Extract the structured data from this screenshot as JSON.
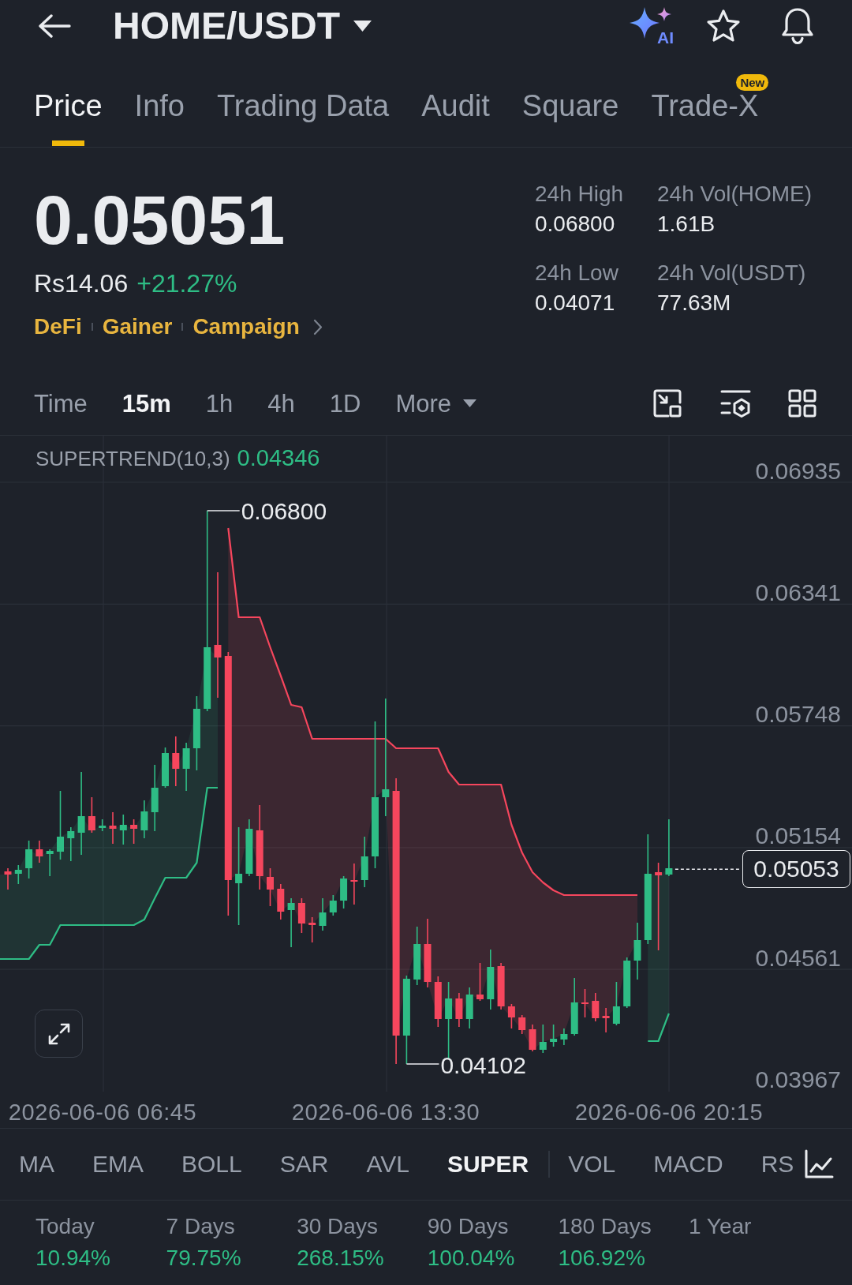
{
  "header": {
    "pair": "HOME/USDT",
    "ai_label": "AI"
  },
  "tabs": [
    {
      "label": "Price",
      "selected": true
    },
    {
      "label": "Info",
      "selected": false
    },
    {
      "label": "Trading Data",
      "selected": false
    },
    {
      "label": "Audit",
      "selected": false
    },
    {
      "label": "Square",
      "selected": false
    },
    {
      "label": "Trade-X",
      "selected": false,
      "badge": "New"
    }
  ],
  "ticker": {
    "last_price": "0.05051",
    "fiat_price": "Rs14.06",
    "change": "+21.27%",
    "tags": [
      "DeFi",
      "Gainer",
      "Campaign"
    ]
  },
  "stats": [
    {
      "label": "24h High",
      "value": "0.06800"
    },
    {
      "label": "24h Vol(HOME)",
      "value": "1.61B"
    },
    {
      "label": "24h Low",
      "value": "0.04071"
    },
    {
      "label": "24h Vol(USDT)",
      "value": "77.63M"
    }
  ],
  "intervals": [
    {
      "label": "Time",
      "kind": "option",
      "selected": false
    },
    {
      "label": "15m",
      "kind": "option",
      "selected": true
    },
    {
      "label": "1h",
      "kind": "option",
      "selected": false
    },
    {
      "label": "4h",
      "kind": "option",
      "selected": false
    },
    {
      "label": "1D",
      "kind": "option",
      "selected": false
    },
    {
      "label": "More",
      "kind": "dropdown",
      "selected": false
    }
  ],
  "chart": {
    "indicator": "SUPERTREND(10,3)",
    "indicator_value": "0.04346",
    "price_ticks": [
      "0.06935",
      "0.06341",
      "0.05748",
      "0.05154",
      "0.04561",
      "0.03967"
    ],
    "last_price": "0.05053",
    "high_label": "0.06800",
    "low_label": "0.04102",
    "time_labels": [
      "2026-06-06 06:45",
      "2026-06-06 13:30",
      "2026-06-06 20:15"
    ]
  },
  "main_indicators": [
    {
      "label": "MA",
      "selected": false
    },
    {
      "label": "EMA",
      "selected": false
    },
    {
      "label": "BOLL",
      "selected": false
    },
    {
      "label": "SAR",
      "selected": false
    },
    {
      "label": "AVL",
      "selected": false
    },
    {
      "label": "SUPER",
      "selected": true
    }
  ],
  "sub_indicators": [
    {
      "label": "VOL",
      "selected": false
    },
    {
      "label": "MACD",
      "selected": false
    },
    {
      "label": "RS",
      "selected": false
    }
  ],
  "performance": [
    {
      "label": "Today",
      "value": "10.94%"
    },
    {
      "label": "7 Days",
      "value": "79.75%"
    },
    {
      "label": "30 Days",
      "value": "268.15%"
    },
    {
      "label": "90 Days",
      "value": "100.04%"
    },
    {
      "label": "180 Days",
      "value": "106.92%"
    },
    {
      "label": "1 Year"
    }
  ]
}
